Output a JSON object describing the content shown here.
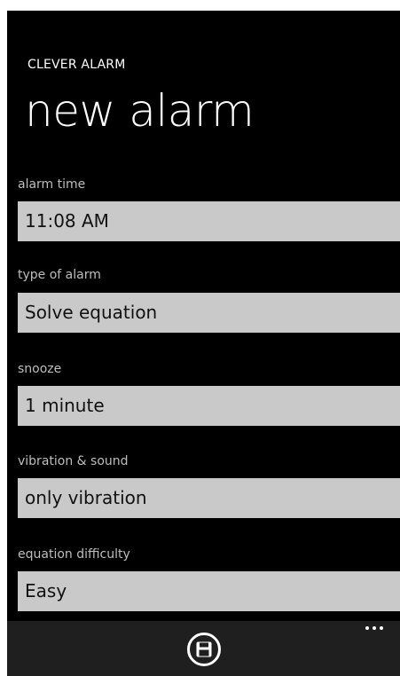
{
  "app": {
    "name": "CLEVER ALARM",
    "page_title": "new alarm"
  },
  "fields": [
    {
      "label": "alarm time",
      "value": "11:08 AM"
    },
    {
      "label": "type of alarm",
      "value": "Solve equation"
    },
    {
      "label": "snooze",
      "value": "1 minute"
    },
    {
      "label": "vibration & sound",
      "value": "only vibration"
    },
    {
      "label": "equation difficulty",
      "value": "Easy"
    }
  ],
  "app_bar": {
    "save_icon": "save-icon",
    "more_icon": "more-icon"
  },
  "colors": {
    "background": "#000000",
    "field_bg": "#c9c9c9",
    "label": "#bdbdbd",
    "app_bar": "#1f1f1f"
  }
}
